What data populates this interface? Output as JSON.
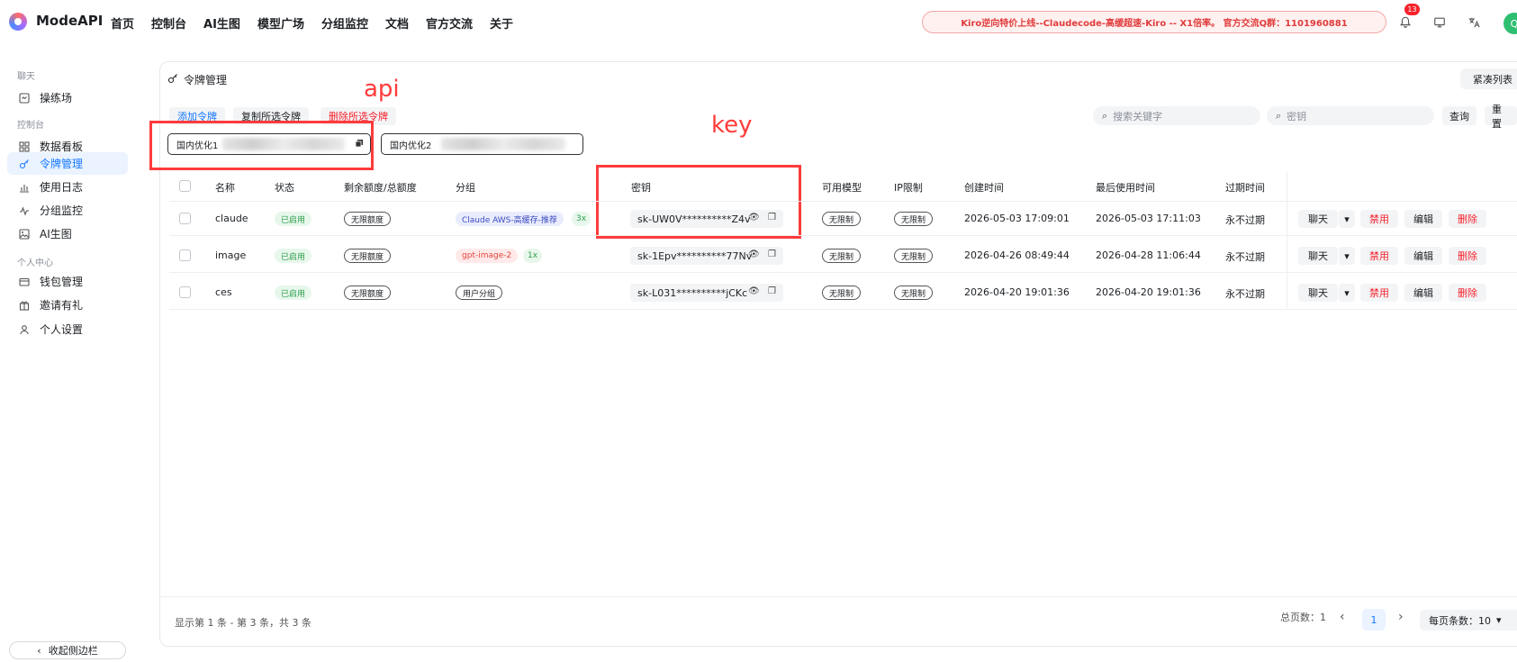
{
  "app": {
    "brand": "ModeAPI"
  },
  "nav": {
    "items": [
      "首页",
      "控制台",
      "AI生图",
      "模型广场",
      "分组监控",
      "文档",
      "官方交流",
      "关于"
    ]
  },
  "announcement": "Kiro逆向特价上线--Claudecode-高缓超速-Kiro -- X1倍率。 官方交流Q群：1101960881",
  "notifications": {
    "count": "13"
  },
  "user": {
    "avatar_letter": "Q"
  },
  "sidebar": {
    "sections": [
      "聊天",
      "控制台",
      "个人中心"
    ],
    "items": [
      "操练场",
      "数据看板",
      "令牌管理",
      "使用日志",
      "分组监控",
      "AI生图",
      "钱包管理",
      "邀请有礼",
      "个人设置"
    ],
    "collapse": "收起侧边栏"
  },
  "page": {
    "title": "令牌管理",
    "compact_toggle": "紧凑列表",
    "actions": {
      "add": "添加令牌",
      "copy_selected": "复制所选令牌",
      "delete_selected": "删除所选令牌"
    },
    "search": {
      "keyword_placeholder": "搜索关键字",
      "key_placeholder": "密钥",
      "query": "查询",
      "reset": "重置"
    },
    "chips": [
      "国内优化1",
      "国内优化2"
    ]
  },
  "annotations": {
    "api_label": "api",
    "key_label": "key"
  },
  "table": {
    "columns": [
      "名称",
      "状态",
      "剩余额度/总额度",
      "分组",
      "密钥",
      "可用模型",
      "IP限制",
      "创建时间",
      "最后使用时间",
      "过期时间"
    ],
    "rows": [
      {
        "name": "claude",
        "status": "已启用",
        "quota": "无限额度",
        "group": "Claude AWS-高缓存-推荐",
        "ratio": "3x",
        "key": "sk-UW0V**********Z4v",
        "models": "无限制",
        "ip": "无限制",
        "created": "2026-05-03 17:09:01",
        "last_used": "2026-05-03 17:11:03",
        "expires": "永不过期"
      },
      {
        "name": "image",
        "status": "已启用",
        "quota": "无限额度",
        "group": "gpt-image-2",
        "ratio": "1x",
        "key": "sk-1Epv**********77Nv",
        "models": "无限制",
        "ip": "无限制",
        "created": "2026-04-26 08:49:44",
        "last_used": "2026-04-28 11:06:44",
        "expires": "永不过期"
      },
      {
        "name": "ces",
        "status": "已启用",
        "quota": "无限额度",
        "group": "用户分组",
        "ratio": "",
        "key": "sk-L031**********jCKc",
        "models": "无限制",
        "ip": "无限制",
        "created": "2026-04-20 19:01:36",
        "last_used": "2026-04-20 19:01:36",
        "expires": "永不过期"
      }
    ],
    "row_actions": {
      "chat": "聊天",
      "disable": "禁用",
      "edit": "编辑",
      "delete": "删除"
    }
  },
  "footer": {
    "summary": "显示第 1 条 - 第 3 条，共 3 条",
    "total_pages": "总页数：1",
    "current_page": "1",
    "per_page": "每页条数：10"
  }
}
